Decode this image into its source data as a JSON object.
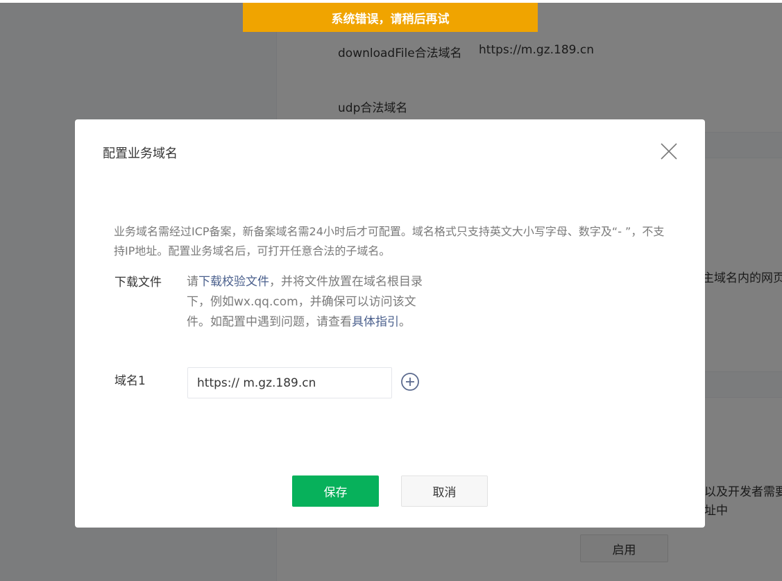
{
  "toast": {
    "message": "系统错误，请稍后再试"
  },
  "background": {
    "download_file_label": "downloadFile合法域名",
    "download_file_value": "https://m.gz.189.cn",
    "udp_label": "udp合法域名",
    "partial_text_1": "主域名内的网页",
    "partial_text_2": "以及开发者需要",
    "partial_text_3": "址中",
    "enable_button": "启用"
  },
  "dialog": {
    "title": "配置业务域名",
    "notice": "业务域名需经过ICP备案，新备案域名需24小时后才可配置。域名格式只支持英文大小写字母、数字及“- ”，不支持IP地址。配置业务域名后，可打开任意合法的子域名。",
    "download": {
      "label": "下载文件",
      "prefix": "请",
      "link1": "下载校验文件",
      "middle": "，并将文件放置在域名根目录下，例如wx.qq.com，并确保可以访问该文件。如配置中遇到问题，请查看",
      "link2": "具体指引",
      "suffix": "。"
    },
    "domain": {
      "label": "域名1",
      "value": "https:// m.gz.189.cn"
    },
    "save_label": "保存",
    "cancel_label": "取消"
  },
  "colors": {
    "toast": "#f0a400",
    "primary": "#07b15b",
    "link": "#4a5f8c"
  },
  "icons": {
    "close": "close-icon",
    "add": "plus-circle-icon"
  }
}
